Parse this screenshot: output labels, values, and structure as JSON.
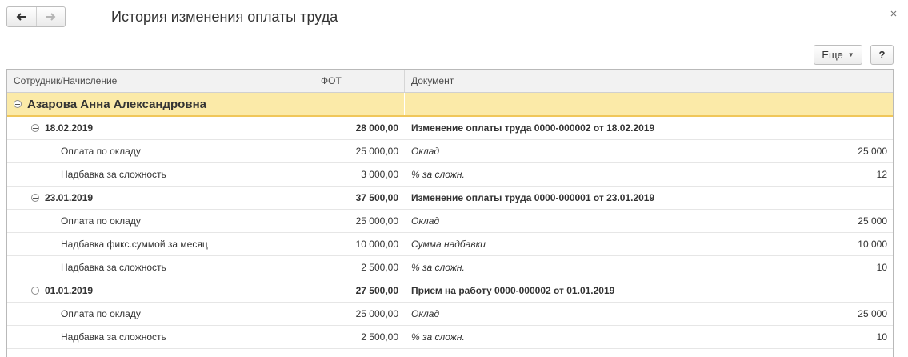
{
  "window": {
    "title": "История изменения оплаты труда"
  },
  "toolbar": {
    "more_label": "Еще",
    "help_label": "?"
  },
  "columns": [
    "Сотрудник/Начисление",
    "ФОТ",
    "Документ"
  ],
  "employee": {
    "name": "Азарова Анна Александровна"
  },
  "periods": [
    {
      "date": "18.02.2019",
      "fot": "28 000,00",
      "document": "Изменение оплаты труда 0000-000002 от 18.02.2019",
      "items": [
        {
          "name": "Оплата по окладу",
          "fot": "25 000,00",
          "indicator": "Оклад",
          "value": "25 000"
        },
        {
          "name": "Надбавка за сложность",
          "fot": "3 000,00",
          "indicator": "% за сложн.",
          "value": "12"
        }
      ]
    },
    {
      "date": "23.01.2019",
      "fot": "37 500,00",
      "document": "Изменение оплаты труда 0000-000001 от 23.01.2019",
      "items": [
        {
          "name": "Оплата по окладу",
          "fot": "25 000,00",
          "indicator": "Оклад",
          "value": "25 000"
        },
        {
          "name": "Надбавка фикс.суммой за месяц",
          "fot": "10 000,00",
          "indicator": "Сумма надбавки",
          "value": "10 000"
        },
        {
          "name": "Надбавка за сложность",
          "fot": "2 500,00",
          "indicator": "% за сложн.",
          "value": "10"
        }
      ]
    },
    {
      "date": "01.01.2019",
      "fot": "27 500,00",
      "document": "Прием на работу 0000-000002 от 01.01.2019",
      "items": [
        {
          "name": "Оплата по окладу",
          "fot": "25 000,00",
          "indicator": "Оклад",
          "value": "25 000"
        },
        {
          "name": "Надбавка за сложность",
          "fot": "2 500,00",
          "indicator": "% за сложн.",
          "value": "10"
        }
      ]
    }
  ],
  "icons": {
    "back": "arrow-left-icon",
    "forward": "arrow-right-icon",
    "close": "close-icon",
    "collapse": "collapse-toggle-icon"
  },
  "colors": {
    "group_row_bg": "#fbeaa8",
    "group_row_border": "#f0c75a",
    "header_bg": "#f2f2f2"
  }
}
